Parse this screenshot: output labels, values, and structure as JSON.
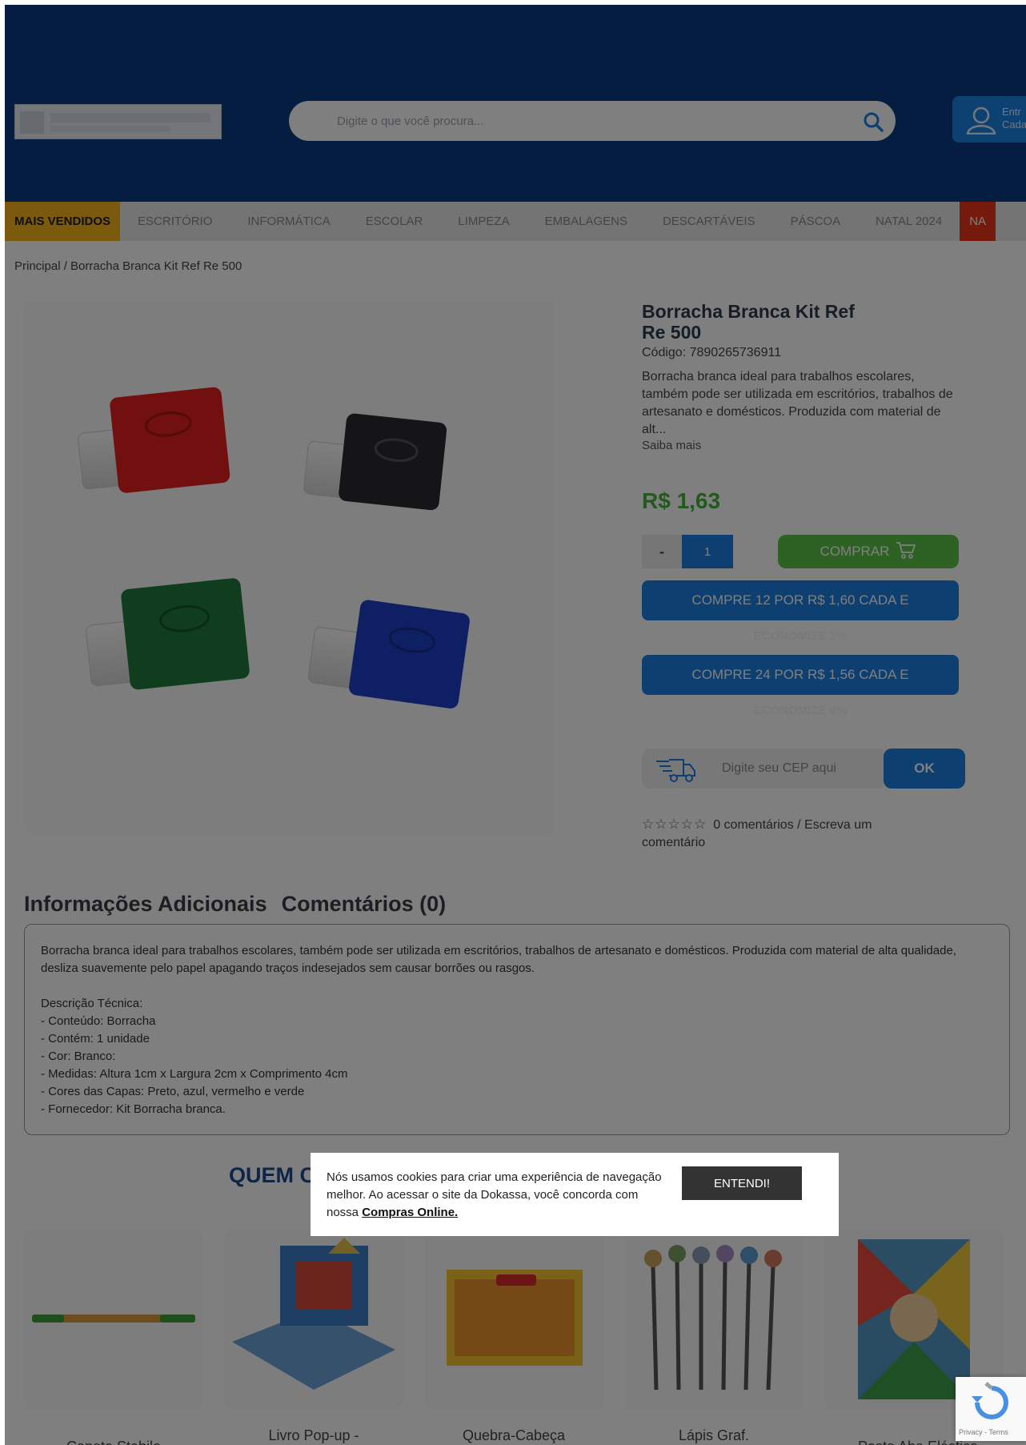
{
  "search": {
    "placeholder": "Digite o que você procura..."
  },
  "account": {
    "line1": "Entr",
    "line2": "Cada"
  },
  "nav": {
    "items": [
      "MAIS VENDIDOS",
      "ESCRITÓRIO",
      "INFORMÁTICA",
      "ESCOLAR",
      "LIMPEZA",
      "EMBALAGENS",
      "DESCARTÁVEIS",
      "PÁSCOA",
      "NATAL 2024",
      "NA"
    ]
  },
  "breadcrumb": {
    "home": "Principal",
    "separator": "/",
    "current": "Borracha Branca Kit Ref Re 500"
  },
  "product": {
    "title": "Borracha Branca Kit Ref Re 500",
    "code": "Código: 7890265736911",
    "description": "Borracha branca ideal para trabalhos escolares, também pode ser utilizada em escritórios, trabalhos de artesanato e domésticos. Produzida com material de alt...",
    "more": "Saiba mais",
    "price": "R$ 1,63",
    "qty_minus": "-",
    "qty_value": "1",
    "buy_label": "COMPRAR",
    "bundle1": "COMPRE 12 POR R$ 1,60 CADA E",
    "bundle1_note": "ECONOMIZE 2%",
    "bundle2": "COMPRE 24 POR R$ 1,56 CADA E",
    "bundle2_note": "ECONOMIZE 4%",
    "cep_placeholder": "Digite seu CEP aqui",
    "ok": "OK",
    "stars": "☆☆☆☆☆",
    "rating_text": "0 comentários / Escreva um comentário",
    "eraser_colors": [
      "#e2211c",
      "#2b2b2e",
      "#1e7a3c",
      "#1f3ec9"
    ]
  },
  "tabs": {
    "info": "Informações Adicionais",
    "comments": "Comentários (0)"
  },
  "details": {
    "paragraph": "Borracha branca ideal para trabalhos escolares, também pode ser utilizada em escritórios, trabalhos de artesanato e domésticos. Produzida com material de alta qualidade, desliza suavemente pelo papel apagando traços indesejados sem causar borrões ou rasgos.",
    "tech_title": "Descrição Técnica:",
    "tech_lines": [
      "- Conteúdo: Borracha",
      "- Contém: 1 unidade",
      "- Cor: Branco:",
      "- Medidas: Altura 1cm x Largura 2cm x Comprimento 4cm",
      "- Cores das Capas: Preto, azul, vermelho e verde",
      "- Fornecedor: Kit Borracha branca."
    ]
  },
  "related": {
    "title": "QUEM C",
    "products": [
      {
        "name": "Caneta Stabilo"
      },
      {
        "name": "Livro Pop-up -"
      },
      {
        "name": "Quebra-Cabeça"
      },
      {
        "name": "Lápis Graf."
      },
      {
        "name": "Pasta Aba Elástica"
      }
    ]
  },
  "cookie": {
    "text": "Nós usamos cookies para criar uma experiência de navegação melhor. Ao acessar o site da Dokassa, você concorda com nossa",
    "link": "Compras Online.",
    "button": "ENTENDI!"
  },
  "recaptcha": {
    "text": "Privacy - Terms"
  },
  "colors": {
    "header": "#0a3a82",
    "nav_highlight": "#f7b41a",
    "price": "#46b23a",
    "primary": "#1a7fe0",
    "buy": "#5cc44a"
  }
}
